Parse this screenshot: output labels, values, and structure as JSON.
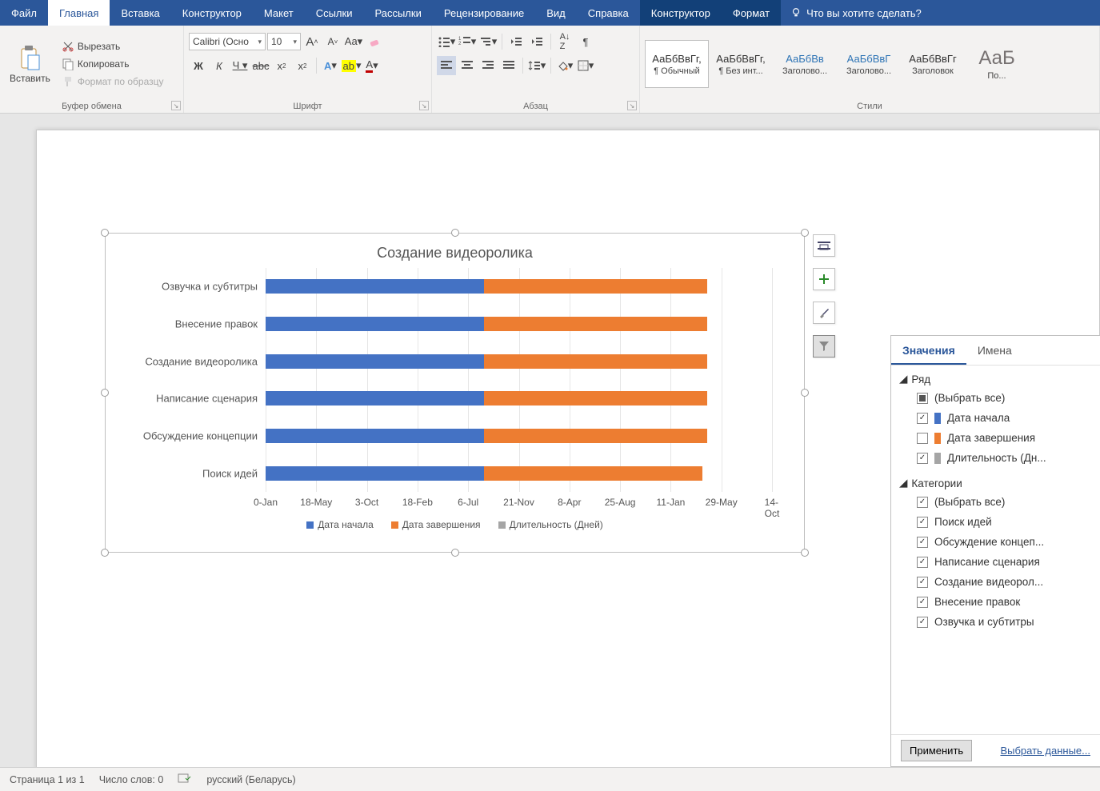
{
  "ribbon": {
    "tabs": [
      "Файл",
      "Главная",
      "Вставка",
      "Конструктор",
      "Макет",
      "Ссылки",
      "Рассылки",
      "Рецензирование",
      "Вид",
      "Справка"
    ],
    "context_tabs": [
      "Конструктор",
      "Формат"
    ],
    "active_tab": "Главная",
    "tell_me": "Что вы хотите сделать?",
    "clipboard": {
      "label": "Буфер обмена",
      "paste": "Вставить",
      "cut": "Вырезать",
      "copy": "Копировать",
      "format_painter": "Формат по образцу"
    },
    "font": {
      "label": "Шрифт",
      "name": "Calibri (Осно",
      "size": "10"
    },
    "paragraph": {
      "label": "Абзац"
    },
    "styles": {
      "label": "Стили",
      "items": [
        {
          "preview": "АаБбВвГг,",
          "name": "¶ Обычный",
          "color": "#333"
        },
        {
          "preview": "АаБбВвГг,",
          "name": "¶ Без инт...",
          "color": "#333"
        },
        {
          "preview": "АаБбВв",
          "name": "Заголово...",
          "color": "#2e74b5"
        },
        {
          "preview": "АаБбВвГ",
          "name": "Заголово...",
          "color": "#2e74b5"
        },
        {
          "preview": "АаБбВвГг",
          "name": "Заголовок",
          "color": "#333"
        },
        {
          "preview": "АаБ",
          "name": "По...",
          "color": "#767171"
        }
      ]
    }
  },
  "chart_data": {
    "type": "bar",
    "orientation": "horizontal",
    "stacked": true,
    "title": "Создание видеоролика",
    "categories": [
      "Озвучка и субтитры",
      "Внесение правок",
      "Создание видеоролика",
      "Написание сценария",
      "Обсуждение концепции",
      "Поиск идей"
    ],
    "x_ticks": [
      "0-Jan",
      "18-May",
      "3-Oct",
      "18-Feb",
      "6-Jul",
      "21-Nov",
      "8-Apr",
      "25-Aug",
      "11-Jan",
      "29-May",
      "14-Oct"
    ],
    "series": [
      {
        "name": "Дата начала",
        "color": "#4472c4",
        "pct": [
          43,
          43,
          43,
          43,
          43,
          43
        ]
      },
      {
        "name": "Дата завершения",
        "color": "#ed7d31",
        "pct": [
          44,
          44,
          44,
          44,
          44,
          43
        ]
      },
      {
        "name": "Длительность (Дней)",
        "color": "#a5a5a5",
        "pct": [
          0,
          0,
          0,
          0,
          0,
          0
        ]
      }
    ],
    "legend": [
      "Дата начала",
      "Дата завершения",
      "Длительность (Дней)"
    ]
  },
  "chart_side": {
    "layout": "layout-options-icon",
    "plus": "chart-elements-icon",
    "brush": "chart-styles-icon",
    "funnel": "chart-filters-icon"
  },
  "filter_pane": {
    "tabs": [
      "Значения",
      "Имена"
    ],
    "active_tab": "Значения",
    "series_label": "Ряд",
    "categories_label": "Категории",
    "select_all": "(Выбрать все)",
    "series": [
      {
        "label": "Дата начала",
        "color": "#4472c4",
        "checked": true
      },
      {
        "label": "Дата завершения",
        "color": "#ed7d31",
        "checked": false
      },
      {
        "label": "Длительность (Дн...",
        "color": "#a5a5a5",
        "checked": true
      }
    ],
    "categories": [
      {
        "label": "(Выбрать все)",
        "checked": true
      },
      {
        "label": "Поиск идей",
        "checked": true
      },
      {
        "label": "Обсуждение концеп...",
        "checked": true
      },
      {
        "label": "Написание сценария",
        "checked": true
      },
      {
        "label": "Создание видеорол...",
        "checked": true
      },
      {
        "label": "Внесение правок",
        "checked": true
      },
      {
        "label": "Озвучка и субтитры",
        "checked": true
      }
    ],
    "apply": "Применить",
    "select_data": "Выбрать данные..."
  },
  "status": {
    "page": "Страница 1 из 1",
    "words": "Число слов: 0",
    "lang": "русский (Беларусь)"
  }
}
